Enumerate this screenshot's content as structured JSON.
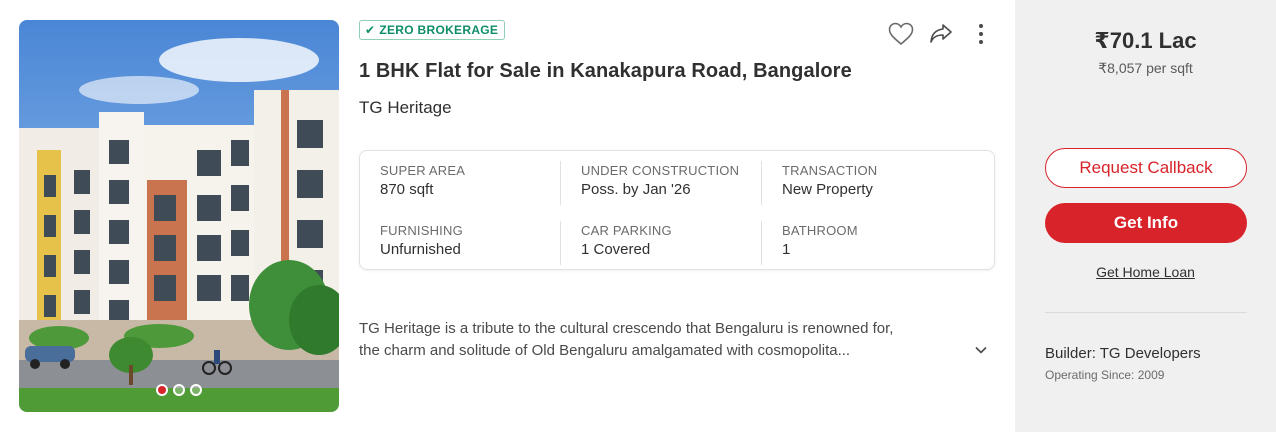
{
  "listing": {
    "badge": "ZERO BROKERAGE",
    "title": "1 BHK Flat for Sale in Kanakapura Road, Bangalore",
    "project": "TG Heritage",
    "photo": {
      "carousel_count": 3,
      "active_index": 0
    },
    "specs": [
      {
        "label": "SUPER AREA",
        "value": "870 sqft"
      },
      {
        "label": "UNDER CONSTRUCTION",
        "value": "Poss. by Jan '26"
      },
      {
        "label": "TRANSACTION",
        "value": "New Property"
      },
      {
        "label": "FURNISHING",
        "value": "Unfurnished"
      },
      {
        "label": "CAR PARKING",
        "value": "1 Covered"
      },
      {
        "label": "BATHROOM",
        "value": "1"
      }
    ],
    "description": {
      "line1": "TG Heritage is a tribute to the cultural crescendo that Bengaluru is renowned for,",
      "line2": "the charm and solitude of Old Bengaluru amalgamated with cosmopolita..."
    },
    "icons": {
      "badge": "check-icon",
      "favorite": "heart-icon",
      "share": "share-icon",
      "menu": "more-vertical-icon",
      "expand": "chevron-down-icon"
    }
  },
  "sidebar": {
    "price": "₹70.1 Lac",
    "price_per_sqft": "₹8,057 per sqft",
    "request_callback": "Request Callback",
    "get_info": "Get Info",
    "home_loan": "Get Home Loan",
    "builder": "Builder: TG Developers",
    "operating_since": "Operating Since: 2009"
  },
  "colors": {
    "accent": "#d8232a",
    "badge_green": "#0e8d6a",
    "sidebar_bg": "#f0f0f0"
  }
}
